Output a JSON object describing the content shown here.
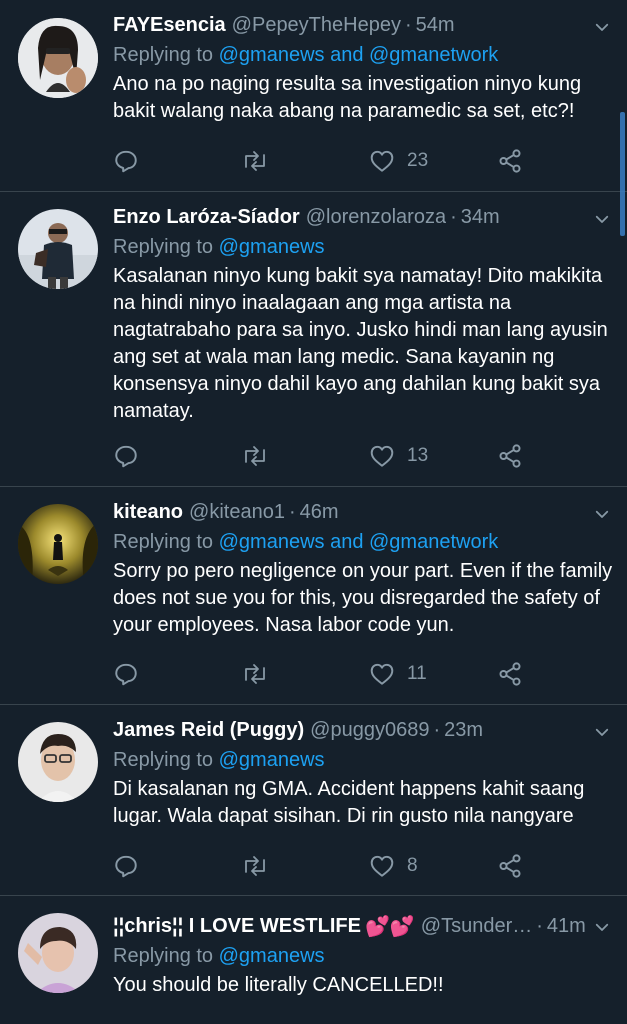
{
  "theme": {
    "bg": "#15202b",
    "text": "#ffffff",
    "muted": "#8899a6",
    "accent": "#1da1f2",
    "divider": "#38444d"
  },
  "tweets": [
    {
      "name": "FAYEsencia",
      "handle": "@PepeyTheHepey",
      "time": "54m",
      "reply_label": "Replying to",
      "mentions": "@gmanews and @gmanetwork",
      "text": "Ano na po naging resulta sa investigation ninyo kung bakit walang naka abang na paramedic sa set, etc?!",
      "likes": "23"
    },
    {
      "name": "Enzo Laróza-Síador",
      "handle": "@lorenzolaroza",
      "time": "34m",
      "reply_label": "Replying to",
      "mentions": "@gmanews",
      "text": "Kasalanan ninyo kung bakit sya namatay! Dito makikita na hindi ninyo inaalagaan ang mga artista na nagtatrabaho para sa inyo. Jusko hindi man lang ayusin ang set at wala man lang medic. Sana kayanin ng konsensya ninyo dahil kayo ang dahilan kung bakit sya namatay.",
      "likes": "13"
    },
    {
      "name": "kiteano",
      "handle": "@kiteano1",
      "time": "46m",
      "reply_label": "Replying to",
      "mentions": "@gmanews and @gmanetwork",
      "text": "Sorry po pero negligence on your part. Even if the family does not sue you for this, you disregarded the safety of your employees. Nasa labor code yun.",
      "likes": "11"
    },
    {
      "name": "James Reid (Puggy)",
      "handle": "@puggy0689",
      "time": "23m",
      "reply_label": "Replying to",
      "mentions": "@gmanews",
      "text": "Di kasalanan ng GMA. Accident happens kahit saang lugar. Wala dapat sisihan. Di rin gusto nila nangyare",
      "likes": "8"
    },
    {
      "name": "¦¦chris¦¦ I LOVE WESTLIFE",
      "name_emoji": "💕💕",
      "handle": "@Tsunder…",
      "time": "41m",
      "reply_label": "Replying to",
      "mentions": "@gmanews",
      "text": "You should be literally CANCELLED!!",
      "likes": ""
    }
  ],
  "icons": {
    "reply": "reply-icon",
    "retweet": "retweet-icon",
    "like": "heart-icon",
    "share": "share-icon",
    "caret": "chevron-down-icon"
  }
}
